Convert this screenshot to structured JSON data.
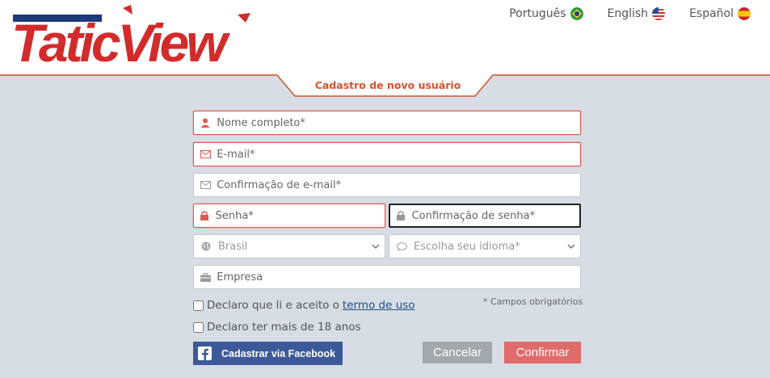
{
  "brand": {
    "logo_text": "TaticView",
    "accent": "#d4532c",
    "primary": "#1e3a7a",
    "red": "#d22b2b"
  },
  "languages": [
    {
      "label": "Português",
      "flag": "brazil-flag-icon"
    },
    {
      "label": "English",
      "flag": "usa-flag-icon"
    },
    {
      "label": "Español",
      "flag": "spain-flag-icon"
    }
  ],
  "form": {
    "title": "Cadastro de novo usuário",
    "full_name": {
      "placeholder": "Nome completo*",
      "icon": "user-icon"
    },
    "email": {
      "placeholder": "E-mail*",
      "icon": "envelope-icon"
    },
    "email_confirm": {
      "placeholder": "Confirmação de e-mail*",
      "icon": "envelope-icon"
    },
    "password": {
      "placeholder": "Senha*",
      "icon": "lock-icon"
    },
    "password_confirm": {
      "placeholder": "Confirmação de senha*",
      "icon": "lock-icon"
    },
    "country": {
      "value": "Brasil",
      "icon": "globe-icon"
    },
    "language": {
      "value": "Escolha seu idioma*",
      "icon": "chat-icon"
    },
    "company": {
      "placeholder": "Empresa",
      "icon": "briefcase-icon"
    },
    "terms_prefix": "Declaro que li e aceito o",
    "terms_link": "termo de uso",
    "age_check": "Declaro ter mais de 18 anos",
    "required_note": "* Campos obrigatórios"
  },
  "buttons": {
    "facebook": "Cadastrar via Facebook",
    "cancel": "Cancelar",
    "confirm": "Confirmar"
  }
}
